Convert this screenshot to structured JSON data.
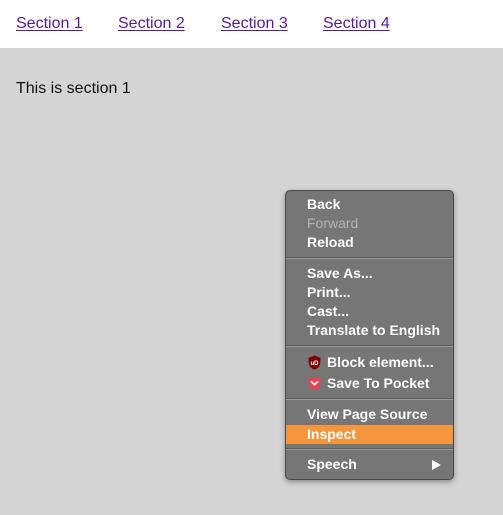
{
  "nav": {
    "links": [
      {
        "label": "Section 1"
      },
      {
        "label": "Section 2"
      },
      {
        "label": "Section 3"
      },
      {
        "label": "Section 4"
      }
    ]
  },
  "main": {
    "text": "This is section 1"
  },
  "context_menu": {
    "back": "Back",
    "forward": "Forward",
    "reload": "Reload",
    "save_as": "Save As...",
    "print": "Print...",
    "cast": "Cast...",
    "translate": "Translate to English",
    "block_element": "Block element...",
    "save_to_pocket": "Save To Pocket",
    "view_source": "View Page Source",
    "inspect": "Inspect",
    "speech": "Speech"
  },
  "colors": {
    "link": "#5a1b99",
    "content_bg": "#d4d4d4",
    "menu_bg": "#767676",
    "highlight": "#f5953d",
    "ublock_red": "#800000",
    "pocket_red": "#ef4056"
  },
  "icons": {
    "block_element": "ublock-origin-icon",
    "save_to_pocket": "pocket-icon",
    "speech_submenu": "submenu-arrow-icon"
  }
}
